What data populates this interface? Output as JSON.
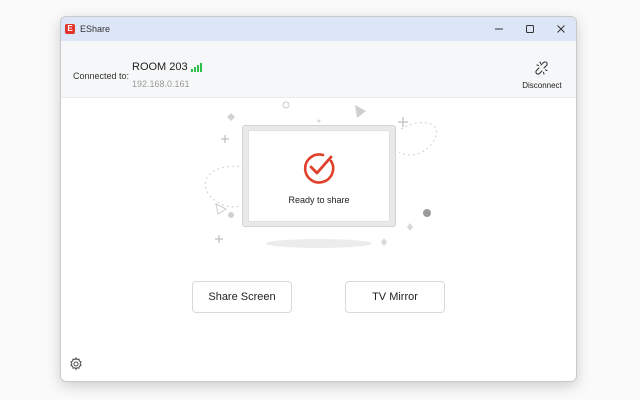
{
  "app": {
    "logo_letter": "E",
    "title": "EShare"
  },
  "window_controls": {
    "minimize": "minimize-icon",
    "maximize": "maximize-icon",
    "close": "close-icon"
  },
  "connection": {
    "label": "Connected to:",
    "room": "ROOM 203",
    "ip": "192.168.0.161",
    "signal_color": "#2dbe4e",
    "disconnect_label": "Disconnect"
  },
  "status": {
    "text": "Ready to share",
    "accent": "#e0402a"
  },
  "actions": {
    "share_screen": "Share Screen",
    "tv_mirror": "TV Mirror"
  },
  "settings": {
    "icon": "gear-icon"
  }
}
